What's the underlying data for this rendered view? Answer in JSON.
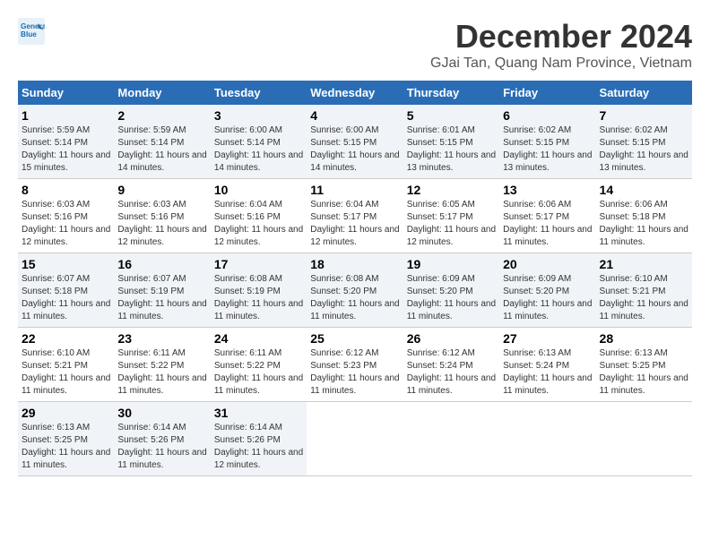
{
  "header": {
    "logo_line1": "General",
    "logo_line2": "Blue",
    "month": "December 2024",
    "location": "GJai Tan, Quang Nam Province, Vietnam"
  },
  "weekdays": [
    "Sunday",
    "Monday",
    "Tuesday",
    "Wednesday",
    "Thursday",
    "Friday",
    "Saturday"
  ],
  "weeks": [
    [
      {
        "day": "1",
        "sunrise": "5:59 AM",
        "sunset": "5:14 PM",
        "daylight": "11 hours and 15 minutes."
      },
      {
        "day": "2",
        "sunrise": "5:59 AM",
        "sunset": "5:14 PM",
        "daylight": "11 hours and 14 minutes."
      },
      {
        "day": "3",
        "sunrise": "6:00 AM",
        "sunset": "5:14 PM",
        "daylight": "11 hours and 14 minutes."
      },
      {
        "day": "4",
        "sunrise": "6:00 AM",
        "sunset": "5:15 PM",
        "daylight": "11 hours and 14 minutes."
      },
      {
        "day": "5",
        "sunrise": "6:01 AM",
        "sunset": "5:15 PM",
        "daylight": "11 hours and 13 minutes."
      },
      {
        "day": "6",
        "sunrise": "6:02 AM",
        "sunset": "5:15 PM",
        "daylight": "11 hours and 13 minutes."
      },
      {
        "day": "7",
        "sunrise": "6:02 AM",
        "sunset": "5:15 PM",
        "daylight": "11 hours and 13 minutes."
      }
    ],
    [
      {
        "day": "8",
        "sunrise": "6:03 AM",
        "sunset": "5:16 PM",
        "daylight": "11 hours and 12 minutes."
      },
      {
        "day": "9",
        "sunrise": "6:03 AM",
        "sunset": "5:16 PM",
        "daylight": "11 hours and 12 minutes."
      },
      {
        "day": "10",
        "sunrise": "6:04 AM",
        "sunset": "5:16 PM",
        "daylight": "11 hours and 12 minutes."
      },
      {
        "day": "11",
        "sunrise": "6:04 AM",
        "sunset": "5:17 PM",
        "daylight": "11 hours and 12 minutes."
      },
      {
        "day": "12",
        "sunrise": "6:05 AM",
        "sunset": "5:17 PM",
        "daylight": "11 hours and 12 minutes."
      },
      {
        "day": "13",
        "sunrise": "6:06 AM",
        "sunset": "5:17 PM",
        "daylight": "11 hours and 11 minutes."
      },
      {
        "day": "14",
        "sunrise": "6:06 AM",
        "sunset": "5:18 PM",
        "daylight": "11 hours and 11 minutes."
      }
    ],
    [
      {
        "day": "15",
        "sunrise": "6:07 AM",
        "sunset": "5:18 PM",
        "daylight": "11 hours and 11 minutes."
      },
      {
        "day": "16",
        "sunrise": "6:07 AM",
        "sunset": "5:19 PM",
        "daylight": "11 hours and 11 minutes."
      },
      {
        "day": "17",
        "sunrise": "6:08 AM",
        "sunset": "5:19 PM",
        "daylight": "11 hours and 11 minutes."
      },
      {
        "day": "18",
        "sunrise": "6:08 AM",
        "sunset": "5:20 PM",
        "daylight": "11 hours and 11 minutes."
      },
      {
        "day": "19",
        "sunrise": "6:09 AM",
        "sunset": "5:20 PM",
        "daylight": "11 hours and 11 minutes."
      },
      {
        "day": "20",
        "sunrise": "6:09 AM",
        "sunset": "5:20 PM",
        "daylight": "11 hours and 11 minutes."
      },
      {
        "day": "21",
        "sunrise": "6:10 AM",
        "sunset": "5:21 PM",
        "daylight": "11 hours and 11 minutes."
      }
    ],
    [
      {
        "day": "22",
        "sunrise": "6:10 AM",
        "sunset": "5:21 PM",
        "daylight": "11 hours and 11 minutes."
      },
      {
        "day": "23",
        "sunrise": "6:11 AM",
        "sunset": "5:22 PM",
        "daylight": "11 hours and 11 minutes."
      },
      {
        "day": "24",
        "sunrise": "6:11 AM",
        "sunset": "5:22 PM",
        "daylight": "11 hours and 11 minutes."
      },
      {
        "day": "25",
        "sunrise": "6:12 AM",
        "sunset": "5:23 PM",
        "daylight": "11 hours and 11 minutes."
      },
      {
        "day": "26",
        "sunrise": "6:12 AM",
        "sunset": "5:24 PM",
        "daylight": "11 hours and 11 minutes."
      },
      {
        "day": "27",
        "sunrise": "6:13 AM",
        "sunset": "5:24 PM",
        "daylight": "11 hours and 11 minutes."
      },
      {
        "day": "28",
        "sunrise": "6:13 AM",
        "sunset": "5:25 PM",
        "daylight": "11 hours and 11 minutes."
      }
    ],
    [
      {
        "day": "29",
        "sunrise": "6:13 AM",
        "sunset": "5:25 PM",
        "daylight": "11 hours and 11 minutes."
      },
      {
        "day": "30",
        "sunrise": "6:14 AM",
        "sunset": "5:26 PM",
        "daylight": "11 hours and 11 minutes."
      },
      {
        "day": "31",
        "sunrise": "6:14 AM",
        "sunset": "5:26 PM",
        "daylight": "11 hours and 12 minutes."
      },
      null,
      null,
      null,
      null
    ]
  ]
}
